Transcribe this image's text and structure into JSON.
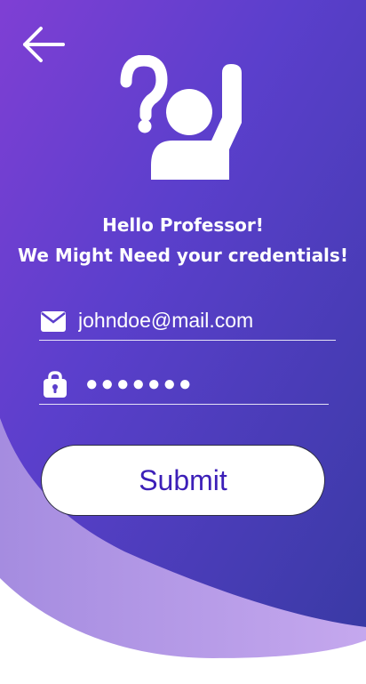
{
  "header": {
    "headline_line1": "Hello Professor!",
    "headline_line2": "We Might Need your credentials!"
  },
  "icons": {
    "back": "arrow-left-icon",
    "hero": "raised-hand-question-icon",
    "email": "mail-icon",
    "password": "lock-icon"
  },
  "form": {
    "email_value": "johndoe@mail.com",
    "password_value": "●●●●●●●",
    "submit_label": "Submit"
  },
  "colors": {
    "gradient_start": "#7a3fd1",
    "gradient_end": "#3c3ca8",
    "accent_text": "#3c1fb8",
    "lower_wave": "#b89ce6"
  }
}
